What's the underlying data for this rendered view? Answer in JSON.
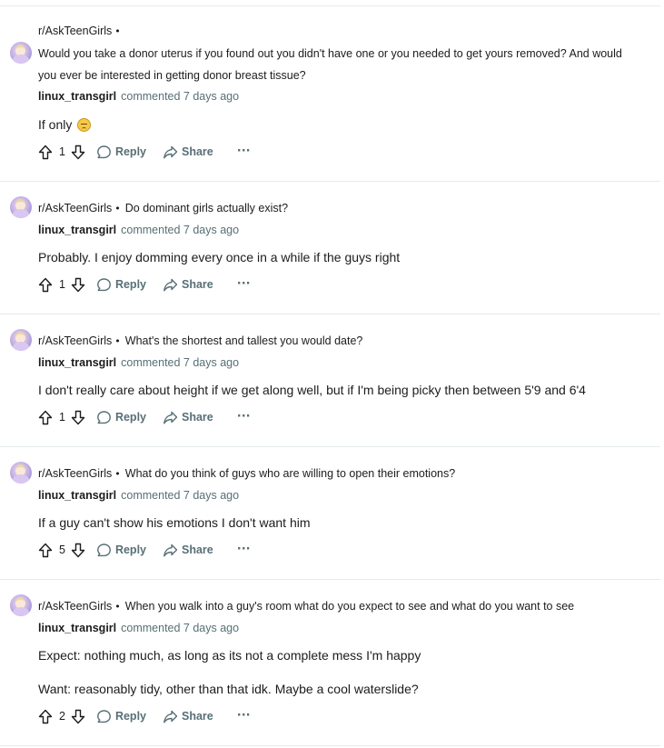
{
  "comments": [
    {
      "subreddit": "r/AskTeenGirls",
      "separator": "•",
      "post_title": "Would you take a donor uterus if you found out you didn't have one or you needed to get yours removed? And would you ever be interested in getting donor breast tissue?",
      "author": "linux_transgirl",
      "meta": "commented 7 days ago",
      "body": [
        "If only"
      ],
      "emoji": "pensive-face-emoji",
      "votes": "1",
      "reply_label": "Reply",
      "share_label": "Share",
      "more_label": "···"
    },
    {
      "subreddit": "r/AskTeenGirls",
      "separator": "•",
      "post_title": "Do dominant girls actually exist?",
      "author": "linux_transgirl",
      "meta": "commented 7 days ago",
      "body": [
        "Probably. I enjoy domming every once in a while if the guys right"
      ],
      "votes": "1",
      "reply_label": "Reply",
      "share_label": "Share",
      "more_label": "···"
    },
    {
      "subreddit": "r/AskTeenGirls",
      "separator": "•",
      "post_title": "What's the shortest and tallest you would date?",
      "author": "linux_transgirl",
      "meta": "commented 7 days ago",
      "body": [
        "I don't really care about height if we get along well, but if I'm being picky then between 5'9 and 6'4"
      ],
      "votes": "1",
      "reply_label": "Reply",
      "share_label": "Share",
      "more_label": "···"
    },
    {
      "subreddit": "r/AskTeenGirls",
      "separator": "•",
      "post_title": "What do you think of guys who are willing to open their emotions?",
      "author": "linux_transgirl",
      "meta": "commented 7 days ago",
      "body": [
        "If a guy can't show his emotions I don't want him"
      ],
      "votes": "5",
      "reply_label": "Reply",
      "share_label": "Share",
      "more_label": "···"
    },
    {
      "subreddit": "r/AskTeenGirls",
      "separator": "•",
      "post_title": "When you walk into a guy's room what do you expect to see and what do you want to see",
      "author": "linux_transgirl",
      "meta": "commented 7 days ago",
      "body": [
        "Expect: nothing much, as long as its not a complete mess I'm happy",
        "Want: reasonably tidy, other than that idk. Maybe a cool waterslide?"
      ],
      "votes": "2",
      "reply_label": "Reply",
      "share_label": "Share",
      "more_label": "···"
    }
  ],
  "icons": {
    "upvote": "upvote-arrow-icon",
    "downvote": "downvote-arrow-icon",
    "reply": "speech-bubble-icon",
    "share": "share-arrow-icon",
    "more": "ellipsis-icon"
  },
  "colors": {
    "text": "#1c1c1c",
    "muted": "#576f76",
    "divider": "#e5ebee"
  }
}
